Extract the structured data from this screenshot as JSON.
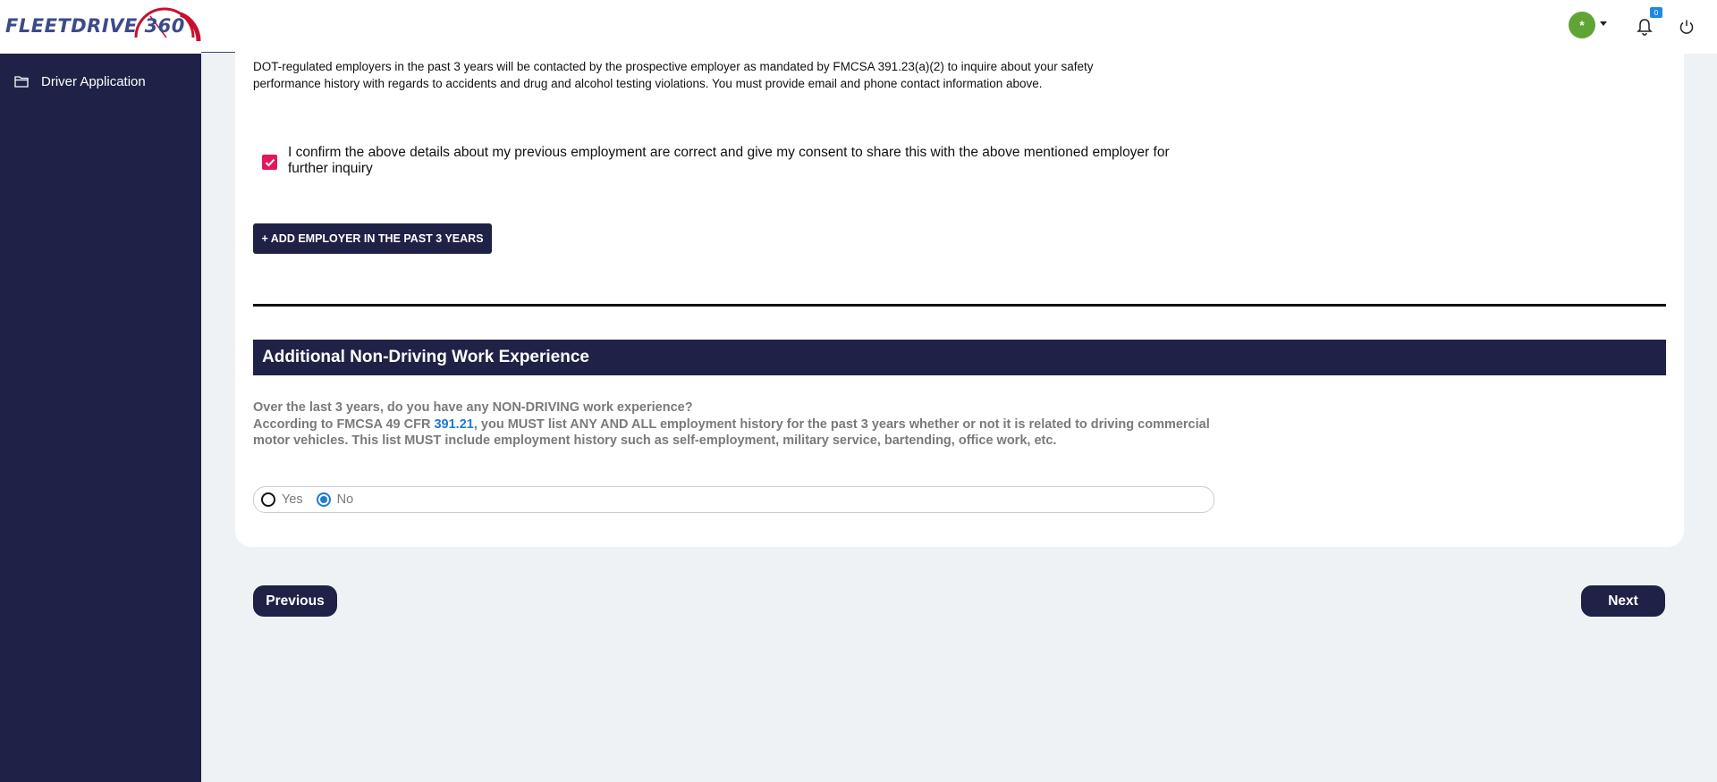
{
  "header": {
    "logo_text": "FLEETDRIVE 360",
    "avatar_initial": "*",
    "notification_count": "0"
  },
  "sidebar": {
    "items": [
      {
        "label": "Driver Application",
        "icon": "folder-icon"
      }
    ]
  },
  "form": {
    "intro_text": "DOT-regulated employers in the past 3 years will be contacted by the prospective employer as mandated by FMCSA 391.23(a)(2) to inquire about your safety performance history with regards to accidents and drug and alcohol testing violations. You must provide email and phone contact information above.",
    "confirm_text": "I confirm the above details about my previous employment are correct and give my consent to share this with the above mentioned employer for further inquiry",
    "confirm_checked": true,
    "add_employer_label": "+ ADD EMPLOYER IN THE PAST 3 YEARS",
    "section_title": "Additional Non-Driving Work Experience",
    "question_line1": "Over the last 3 years, do you have any NON-DRIVING work experience?",
    "question_prefix": "According to FMCSA 49 CFR ",
    "question_link": "391.21",
    "question_suffix": ", you MUST list ANY AND ALL employment history for the past 3 years whether or not it is related to driving commercial motor vehicles. This list MUST include employment history such as self-employment, military service, bartending, office work, etc.",
    "options": [
      {
        "label": "Yes",
        "selected": false
      },
      {
        "label": "No",
        "selected": true
      }
    ]
  },
  "navigation": {
    "previous_label": "Previous",
    "next_label": "Next"
  },
  "colors": {
    "navy": "#1f2246",
    "checkbox": "#e1185f",
    "link": "#1e7ad6",
    "avatar": "#5fa535"
  }
}
